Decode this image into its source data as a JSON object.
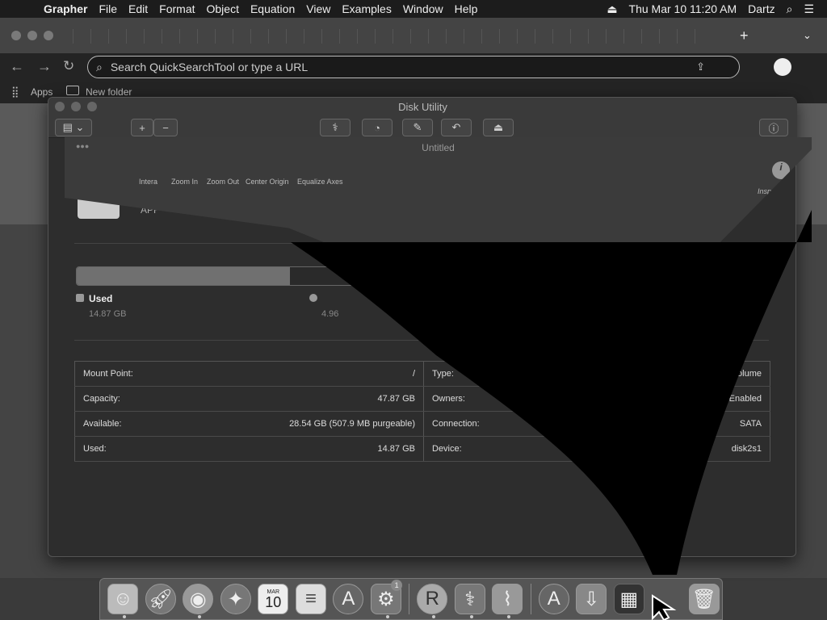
{
  "menubar": {
    "app": "Grapher",
    "items": [
      "File",
      "Edit",
      "Format",
      "Object",
      "Equation",
      "View",
      "Examples",
      "Window",
      "Help"
    ],
    "datetime": "Thu Mar 10  11:20 AM",
    "user": "Dartz"
  },
  "browser": {
    "new_tab": "+",
    "search_placeholder": "Search QuickSearchTool or type a URL",
    "bookmarks": {
      "apps": "Apps",
      "folder": "New folder"
    }
  },
  "disk_utility": {
    "title": "Disk Utility",
    "volume_label": "APF",
    "used_label": "Used",
    "used_value": "14.87 GB",
    "free_value": "4.96",
    "used_fraction": 0.31,
    "info_left": [
      {
        "label": "Mount Point:",
        "value": "/"
      },
      {
        "label": "Capacity:",
        "value": "47.87 GB"
      },
      {
        "label": "Available:",
        "value": "28.54 GB (507.9 MB purgeable)"
      },
      {
        "label": "Used:",
        "value": "14.87 GB"
      }
    ],
    "info_right": [
      {
        "label": "Type:",
        "value": "S Volume"
      },
      {
        "label": "Owners:",
        "value": "Enabled"
      },
      {
        "label": "Connection:",
        "value": "SATA"
      },
      {
        "label": "Device:",
        "value": "disk2s1"
      }
    ]
  },
  "grapher_window": {
    "title": "Untitled",
    "inspector": "Inspector",
    "tools": [
      "Intera",
      "Zoom In",
      "Zoom Out",
      "Center Origin",
      "Equalize Axes"
    ]
  },
  "dock": {
    "calendar_month": "MAR",
    "calendar_day": "10",
    "prefs_badge": "1"
  }
}
